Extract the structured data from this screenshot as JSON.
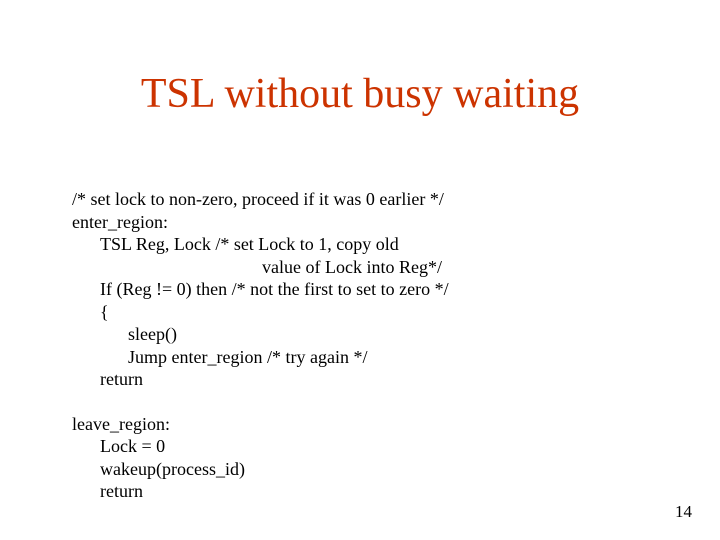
{
  "title": "TSL without busy waiting",
  "lines": {
    "l1": "/* set lock to non-zero, proceed if it was 0 earlier */",
    "l2": "enter_region:",
    "l3": "TSL  Reg, Lock  /* set Lock to 1, copy old",
    "l4": "value of Lock into Reg*/",
    "l5": "If (Reg != 0) then    /* not the first to set to zero */",
    "l6": " {",
    "l7": "sleep()",
    "l8": "Jump enter_region  /* try again */",
    "l9": "return",
    "l10": "leave_region:",
    "l11": " Lock  =  0",
    "l12": " wakeup(process_id)",
    "l13": " return"
  },
  "page_number": "14"
}
